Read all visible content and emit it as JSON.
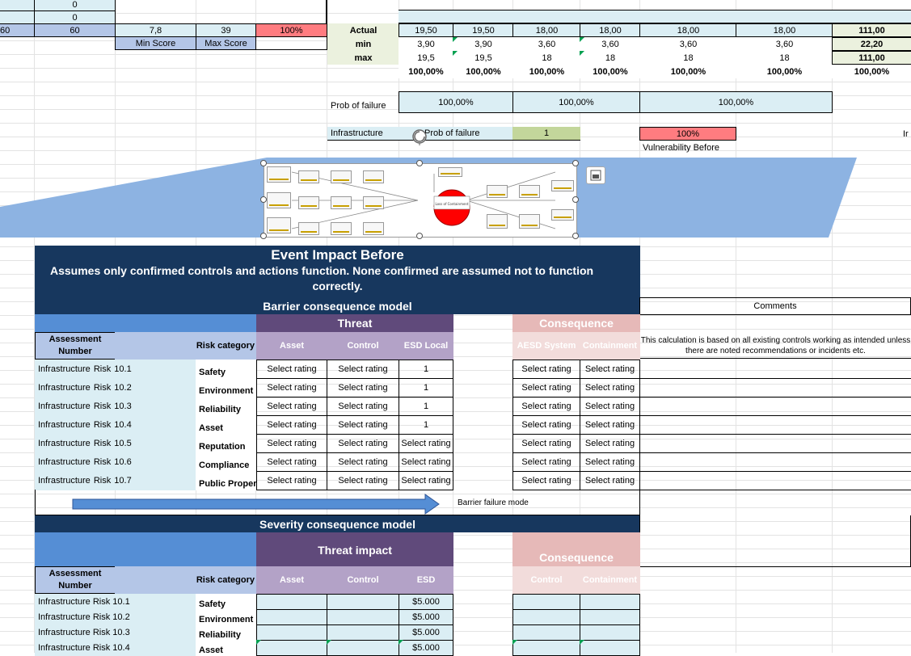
{
  "topblock": {
    "r1": {
      "b": "0"
    },
    "r2": {
      "b": "0"
    },
    "r3": {
      "a": "60",
      "b": "60",
      "c": "7,8",
      "d": "39",
      "e": "100%"
    },
    "min_score": "Min Score",
    "max_score": "Max Score"
  },
  "scores": {
    "labels": [
      "Actual",
      "min",
      "max"
    ],
    "actual": [
      "19,50",
      "19,50",
      "18,00",
      "18,00",
      "18,00",
      "18,00",
      "111,00"
    ],
    "min": [
      "3,90",
      "3,90",
      "3,60",
      "3,60",
      "3,60",
      "3,60",
      "22,20"
    ],
    "max": [
      "19,5",
      "19,5",
      "18",
      "18",
      "18",
      "18",
      "111,00"
    ],
    "pct": [
      "100,00%",
      "100,00%",
      "100,00%",
      "100,00%",
      "100,00%",
      "100,00%",
      "100,00%"
    ]
  },
  "prob": {
    "label": "Prob of failure",
    "v1": "100,00%",
    "v2": "100,00%",
    "v3": "100,00%"
  },
  "infra": {
    "label": "Infrastructure",
    "prob_label": "Prob of failure",
    "value": "1",
    "vuln_value": "100%",
    "vuln_label": "Vulnerability Before",
    "edge_text": "Ir"
  },
  "event_impact": {
    "title": "Event Impact Before",
    "subtitle_line1": "Assumes  only confirmed controls and actions function. None confirmed are assumed not to function",
    "subtitle_line2": "correctly."
  },
  "barrier": {
    "title": "Barrier consequence model",
    "comments_label": "Comments",
    "threat_label": "Threat",
    "consequence_label": "Consequence",
    "assessment_number_label": "Assessment Number",
    "risk_category_label": "Risk category",
    "col_asset": "Asset",
    "col_control": "Control",
    "col_esd_local": "ESD Local",
    "col_aesd_system": "AESD System",
    "col_containment": "Containment",
    "comment_text": "This calculation is based on all existing controls working as intended unless there are noted recommendations or incidents etc.",
    "rows": [
      {
        "name": "Infrastructure  Risk  10.1",
        "category": "Safety",
        "asset": "Select rating",
        "control": "Select rating",
        "esd": "1",
        "aesd": "Select rating",
        "cont": "Select rating"
      },
      {
        "name": "Infrastructure  Risk  10.2",
        "category": "Environment",
        "asset": "Select rating",
        "control": "Select rating",
        "esd": "1",
        "aesd": "Select rating",
        "cont": "Select rating"
      },
      {
        "name": "Infrastructure  Risk  10.3",
        "category": "Reliability",
        "asset": "Select rating",
        "control": "Select rating",
        "esd": "1",
        "aesd": "Select rating",
        "cont": "Select rating"
      },
      {
        "name": "Infrastructure  Risk  10.4",
        "category": "Asset",
        "asset": "Select rating",
        "control": "Select rating",
        "esd": "1",
        "aesd": "Select rating",
        "cont": "Select rating"
      },
      {
        "name": "Infrastructure  Risk  10.5",
        "category": "Reputation",
        "asset": "Select rating",
        "control": "Select rating",
        "esd": "Select rating",
        "aesd": "Select rating",
        "cont": "Select rating"
      },
      {
        "name": "Infrastructure  Risk  10.6",
        "category": "Compliance",
        "asset": "Select rating",
        "control": "Select rating",
        "esd": "Select rating",
        "aesd": "Select rating",
        "cont": "Select rating"
      },
      {
        "name": "Infrastructure  Risk  10.7",
        "category": "Public Property",
        "asset": "Select rating",
        "control": "Select rating",
        "esd": "Select rating",
        "aesd": "Select rating",
        "cont": "Select rating"
      }
    ],
    "failure_mode_label": "Barrier failure mode"
  },
  "severity": {
    "title": "Severity consequence model",
    "threat_impact_label": "Threat impact",
    "consequence_label": "Consequence",
    "assessment_number_label": "Assessment Number",
    "risk_category_label": "Risk category",
    "col_asset": "Asset",
    "col_control": "Control",
    "col_esd": "ESD",
    "col_control2": "Control",
    "col_containment": "Containment",
    "rows": [
      {
        "name": "Infrastructure  Risk  10.1",
        "category": "Safety",
        "esd": "$5.000"
      },
      {
        "name": "Infrastructure  Risk  10.2",
        "category": "Environment",
        "esd": "$5.000"
      },
      {
        "name": "Infrastructure  Risk  10.3",
        "category": "Reliability",
        "esd": "$5.000"
      },
      {
        "name": "Infrastructure  Risk  10.4",
        "category": "Asset",
        "esd": "$5.000"
      }
    ]
  },
  "diagram": {
    "center_label": "Loss of Containment",
    "icon_name": "bowtie-diagram-icon",
    "layout_icon": "layout-options-icon",
    "rotate_icon": "rotate-handle-icon"
  },
  "colors": {
    "navy": "#17375e",
    "threat_purple": "#604a7b",
    "consequence_pink": "#e6b9b8",
    "alert_red": "#ff7c80",
    "light_blue": "#dbeef4"
  }
}
